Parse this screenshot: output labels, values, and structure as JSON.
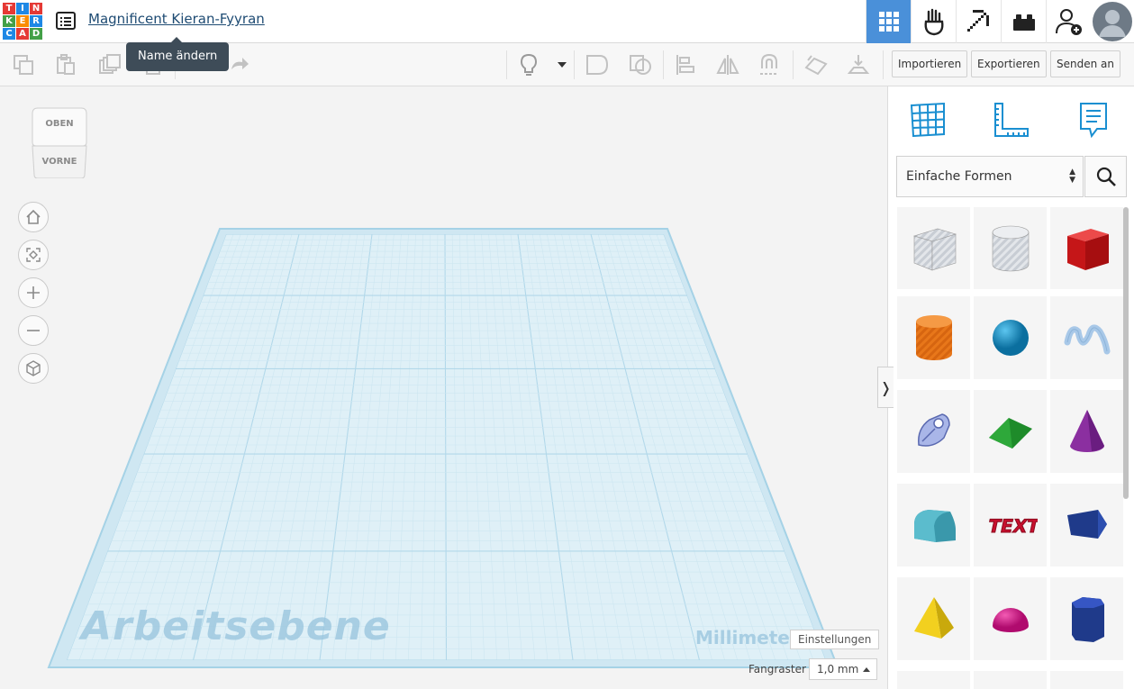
{
  "header": {
    "logo_letters": [
      "T",
      "I",
      "N",
      "K",
      "E",
      "R",
      "C",
      "A",
      "D"
    ],
    "logo_colors": [
      "#e53935",
      "#1e88e5",
      "#e53935",
      "#43a047",
      "#fb8c00",
      "#1e88e5",
      "#1e88e5",
      "#e53935",
      "#43a047"
    ],
    "project_title": "Magnificent Kieran-Fyyran",
    "tooltip": "Name ändern",
    "icons": [
      "grid-view-icon",
      "circuits-icon",
      "minecraft-pickaxe-icon",
      "lego-brick-icon",
      "add-user-icon",
      "avatar"
    ]
  },
  "toolbar": {
    "import_label": "Importieren",
    "export_label": "Exportieren",
    "send_label": "Senden an",
    "icons": [
      "copy-icon",
      "paste-icon",
      "duplicate-icon",
      "delete-icon",
      "undo-icon",
      "redo-icon",
      "light-bulb-icon",
      "dropdown-arrow-icon",
      "group-icon",
      "ungroup-icon",
      "align-icon",
      "mirror-icon",
      "magnet-icon",
      "workplane-icon",
      "drop-icon"
    ]
  },
  "viewport": {
    "viewcube_top": "OBEN",
    "viewcube_front": "VORNE",
    "workplane_label": "Arbeitsebene",
    "units_label": "Millimeter",
    "settings_label": "Einstellungen",
    "snap_grid_label": "Fangraster",
    "snap_grid_value": "1,0 mm",
    "collapse_arrow": "❭"
  },
  "panel": {
    "category": "Einfache Formen",
    "shapes": [
      {
        "name": "box-hole",
        "color": "#c8cdd4"
      },
      {
        "name": "cylinder-hole",
        "color": "#c8cdd4"
      },
      {
        "name": "box",
        "color": "#d7191c"
      },
      {
        "name": "cylinder",
        "color": "#e8771a"
      },
      {
        "name": "sphere",
        "color": "#1397cf"
      },
      {
        "name": "scribble",
        "color": "#a8c8e8"
      },
      {
        "name": "shape-generator",
        "color": "#a9b6e8"
      },
      {
        "name": "roof",
        "color": "#2ea83a"
      },
      {
        "name": "cone",
        "color": "#8b2fa0"
      },
      {
        "name": "round-roof",
        "color": "#5bbccd"
      },
      {
        "name": "text",
        "color": "#c8102e"
      },
      {
        "name": "wedge",
        "color": "#1f3a8a"
      },
      {
        "name": "pyramid",
        "color": "#f2d01f"
      },
      {
        "name": "half-sphere",
        "color": "#e0138a"
      },
      {
        "name": "polygon",
        "color": "#1f3a8a"
      }
    ]
  }
}
